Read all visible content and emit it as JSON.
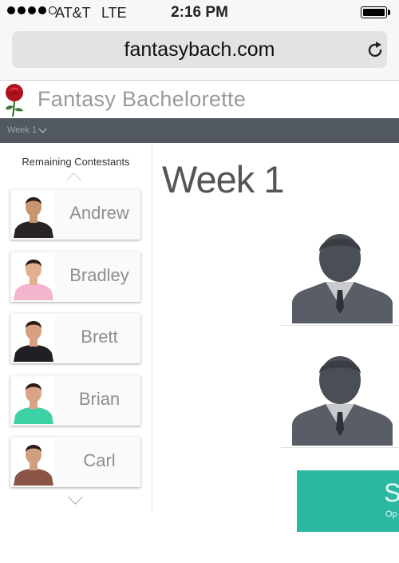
{
  "status_bar": {
    "carrier": "AT&T",
    "network": "LTE",
    "time": "2:16 PM",
    "signal_bars_filled": 4,
    "signal_bars_total": 5
  },
  "browser": {
    "url": "fantasybach.com"
  },
  "app": {
    "title": "Fantasy Bachelorette",
    "week_selector": "Week 1"
  },
  "sidebar": {
    "title": "Remaining Contestants",
    "contestants": [
      {
        "name": "Andrew",
        "shirt_color": "#2a2324",
        "skin": "#c99570"
      },
      {
        "name": "Bradley",
        "shirt_color": "#f4b6cf",
        "skin": "#e3b08f"
      },
      {
        "name": "Brett",
        "shirt_color": "#1f1f24",
        "skin": "#d6a07e"
      },
      {
        "name": "Brian",
        "shirt_color": "#3dd1a6",
        "skin": "#dba386"
      },
      {
        "name": "Carl",
        "shirt_color": "#8a5446",
        "skin": "#d19f80"
      }
    ]
  },
  "main": {
    "heading": "Week 1",
    "tile": {
      "big_text": "S",
      "small_text": "Op",
      "color": "#2bb8a3"
    }
  },
  "colors": {
    "week_bar": "#525860",
    "accent": "#2bb8a3"
  }
}
